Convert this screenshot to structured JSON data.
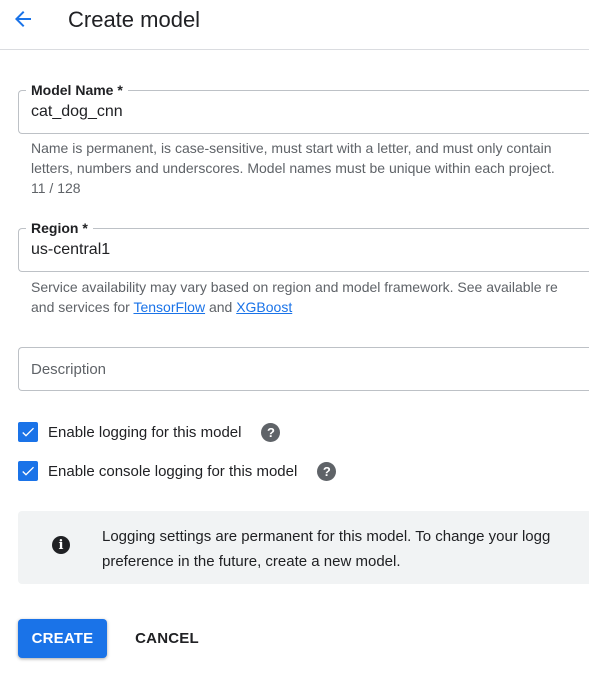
{
  "header": {
    "back_icon": "arrow-left-icon",
    "title": "Create model"
  },
  "form": {
    "model_name": {
      "label": "Model Name *",
      "value": "cat_dog_cnn",
      "hint_line1": "Name is permanent, is case-sensitive, must start with a letter, and must only contain",
      "hint_line2": "letters, numbers and underscores. Model names must be unique within each project.",
      "counter": "11 / 128"
    },
    "region": {
      "label": "Region *",
      "value": "us-central1",
      "hint_line1": "Service availability may vary based on region and model framework. See available re",
      "hint_line2_prefix": "and services for ",
      "link_tensorflow": "TensorFlow",
      "hint_line2_and": " and ",
      "link_xgboost": "XGBoost"
    },
    "description": {
      "placeholder": "Description",
      "value": ""
    },
    "checkboxes": [
      {
        "label": "Enable logging for this model",
        "checked": true,
        "help_icon": "help-icon"
      },
      {
        "label": "Enable console logging for this model",
        "checked": true,
        "help_icon": "help-icon"
      }
    ],
    "info": {
      "icon": "info-icon",
      "line1": "Logging settings are permanent for this model. To change your logg",
      "line2": "preference in the future, create a new model."
    }
  },
  "actions": {
    "create_label": "CREATE",
    "cancel_label": "CANCEL"
  },
  "colors": {
    "accent": "#1a73e8",
    "text": "#202124",
    "hint": "#5f6368",
    "info_bg": "#f1f3f4",
    "border": "#bdc1c6"
  }
}
